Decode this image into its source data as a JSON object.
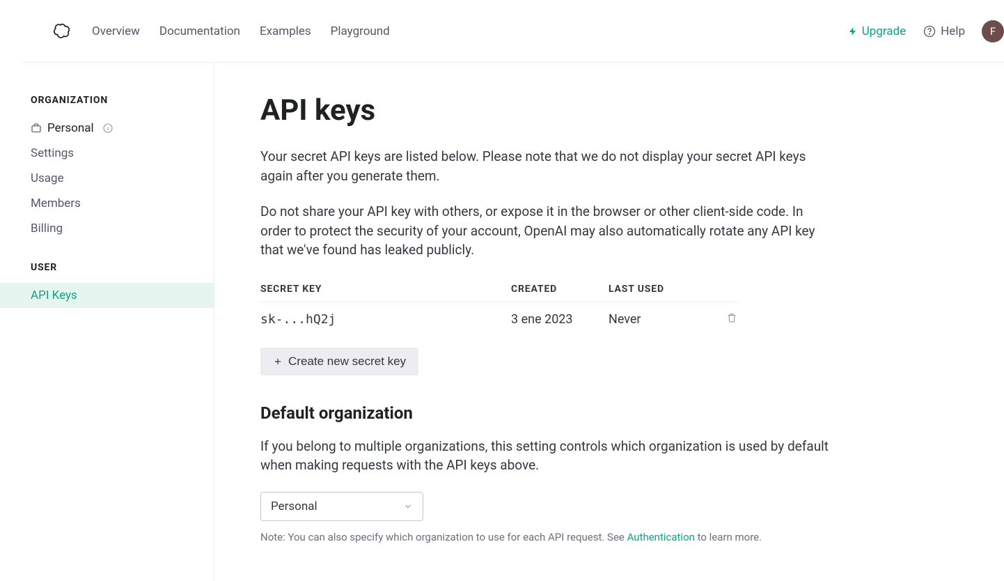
{
  "nav": {
    "items": [
      "Overview",
      "Documentation",
      "Examples",
      "Playground"
    ],
    "upgrade": "Upgrade",
    "help": "Help",
    "avatar_initial": "F"
  },
  "sidebar": {
    "org_label": "ORGANIZATION",
    "org_name": "Personal",
    "org_items": [
      "Settings",
      "Usage",
      "Members",
      "Billing"
    ],
    "user_label": "USER",
    "user_items": [
      "API Keys"
    ]
  },
  "main": {
    "title": "API keys",
    "para1": "Your secret API keys are listed below. Please note that we do not display your secret API keys again after you generate them.",
    "para2": "Do not share your API key with others, or expose it in the browser or other client-side code. In order to protect the security of your account, OpenAI may also automatically rotate any API key that we've found has leaked publicly.",
    "table": {
      "headers": {
        "secret": "SECRET KEY",
        "created": "CREATED",
        "lastused": "LAST USED"
      },
      "rows": [
        {
          "secret": "sk-...hQ2j",
          "created": "3 ene 2023",
          "lastused": "Never"
        }
      ]
    },
    "create_label": "Create new secret key",
    "default_org_title": "Default organization",
    "default_org_para": "If you belong to multiple organizations, this setting controls which organization is used by default when making requests with the API keys above.",
    "org_select_value": "Personal",
    "note_prefix": "Note: You can also specify which organization to use for each API request. See ",
    "note_link": "Authentication",
    "note_suffix": " to learn more."
  }
}
